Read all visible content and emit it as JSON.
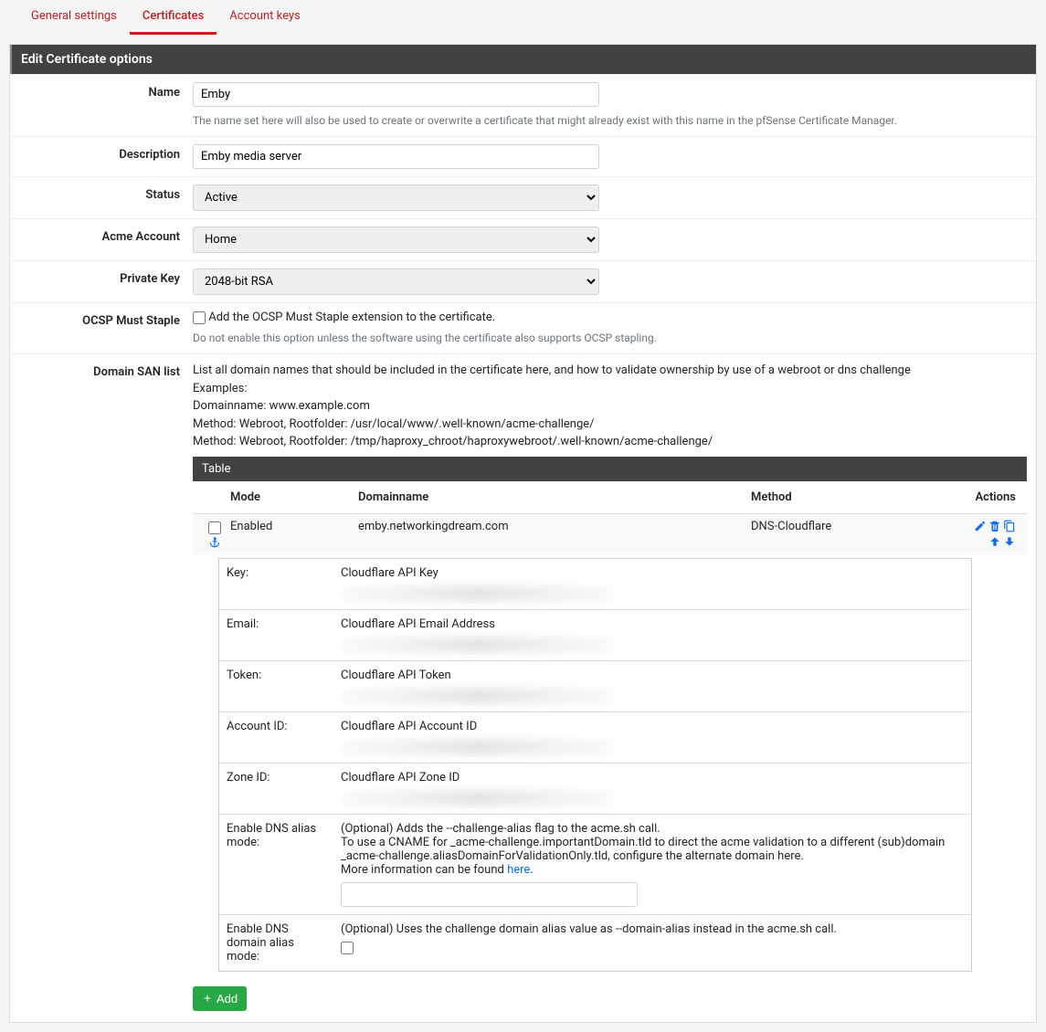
{
  "tabs": {
    "general": "General settings",
    "certificates": "Certificates",
    "accountKeys": "Account keys"
  },
  "panel": {
    "title": "Edit Certificate options"
  },
  "labels": {
    "name": "Name",
    "description": "Description",
    "status": "Status",
    "acmeAccount": "Acme Account",
    "privateKey": "Private Key",
    "ocsp": "OCSP Must Staple",
    "sanList": "Domain SAN list"
  },
  "name": {
    "value": "Emby",
    "help": "The name set here will also be used to create or overwrite a certificate that might already exist with this name in the pfSense Certificate Manager."
  },
  "description": {
    "value": "Emby media server"
  },
  "status": {
    "value": "Active"
  },
  "acmeAccount": {
    "value": "Home"
  },
  "privateKey": {
    "value": "2048-bit RSA"
  },
  "ocsp": {
    "checkbox": "Add the OCSP Must Staple extension to the certificate.",
    "help": "Do not enable this option unless the software using the certificate also supports OCSP stapling."
  },
  "san": {
    "intro1": "List all domain names that should be included in the certificate here, and how to validate ownership by use of a webroot or dns challenge",
    "intro2": "Examples:",
    "intro3": "Domainname: www.example.com",
    "intro4": "Method: Webroot, Rootfolder: /usr/local/www/.well-known/acme-challenge/",
    "intro5": "Method: Webroot, Rootfolder: /tmp/haproxy_chroot/haproxywebroot/.well-known/acme-challenge/"
  },
  "table": {
    "title": "Table",
    "cols": {
      "mode": "Mode",
      "domain": "Domainname",
      "method": "Method",
      "actions": "Actions"
    },
    "row": {
      "mode": "Enabled",
      "domain": "emby.networkingdream.com",
      "method": "DNS-Cloudflare"
    }
  },
  "sub": {
    "key": {
      "label": "Key:",
      "desc": "Cloudflare API Key"
    },
    "email": {
      "label": "Email:",
      "desc": "Cloudflare API Email Address"
    },
    "token": {
      "label": "Token:",
      "desc": "Cloudflare API Token"
    },
    "acct": {
      "label": "Account ID:",
      "desc": "Cloudflare API Account ID"
    },
    "zone": {
      "label": "Zone ID:",
      "desc": "Cloudflare API Zone ID"
    },
    "alias": {
      "label": "Enable DNS alias mode:",
      "l1": "(Optional) Adds the --challenge-alias flag to the acme.sh call.",
      "l2": "To use a CNAME for _acme-challenge.importantDomain.tld to direct the acme validation to a different (sub)domain _acme-challenge.aliasDomainForValidationOnly.tld, configure the alternate domain here.",
      "l3a": "More information can be found ",
      "l3b": "here",
      "l3c": "."
    },
    "domainAlias": {
      "label": "Enable DNS domain alias mode:",
      "desc": "(Optional) Uses the challenge domain alias value as --domain-alias instead in the acme.sh call."
    }
  },
  "addBtn": "Add"
}
